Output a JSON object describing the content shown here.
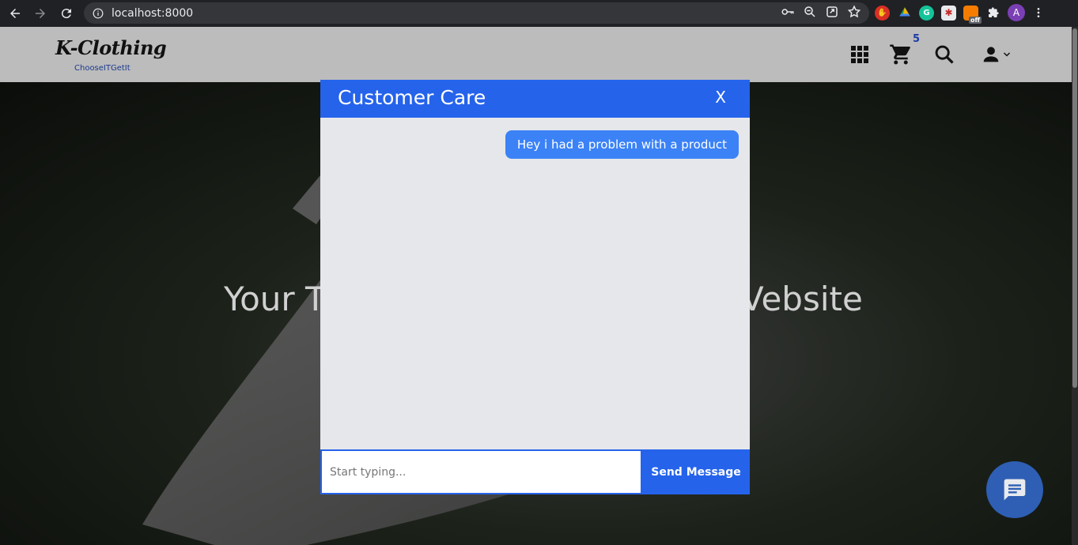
{
  "browser": {
    "url": "localhost:8000",
    "avatar_letter": "A",
    "extensions": [
      "stop-icon",
      "drive-icon",
      "grammarly-icon",
      "puzzle-red-icon",
      "off-badge-icon",
      "extensions-icon"
    ],
    "off_label": "off"
  },
  "header": {
    "logo": "K-Clothing",
    "tagline": "ChooseITGetIt",
    "cart_count": "5"
  },
  "hero": {
    "title_left": "Your T",
    "title_right": "Vebsite"
  },
  "chat": {
    "title": "Customer Care",
    "close_label": "X",
    "messages": [
      {
        "from": "user",
        "text": "Hey i had a problem with a product"
      }
    ],
    "input_placeholder": "Start typing...",
    "send_label": "Send Message"
  },
  "colors": {
    "primary": "#2563eb",
    "bubble": "#3b82f6",
    "header_bg": "#bcbcbc",
    "fab": "#2f5fb4"
  }
}
